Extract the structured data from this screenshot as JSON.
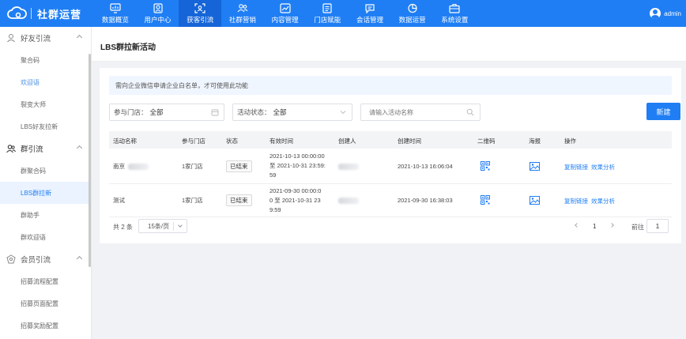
{
  "brand": {
    "name": "社群运营"
  },
  "nav": [
    {
      "label": "数据概览",
      "icon": "chart-screen-icon"
    },
    {
      "label": "用户中心",
      "icon": "user-icon"
    },
    {
      "label": "获客引流",
      "icon": "scan-icon",
      "active": true
    },
    {
      "label": "社群营销",
      "icon": "group-icon"
    },
    {
      "label": "内容管理",
      "icon": "trend-icon"
    },
    {
      "label": "门店赋能",
      "icon": "store-icon"
    },
    {
      "label": "会话管理",
      "icon": "chat-icon"
    },
    {
      "label": "数据运营",
      "icon": "pie-icon"
    },
    {
      "label": "系统设置",
      "icon": "briefcase-icon"
    }
  ],
  "user": {
    "name": "admin"
  },
  "sidebar": {
    "groups": [
      {
        "label": "好友引流",
        "icon": "friend-icon",
        "items": [
          "聚合码",
          "欢迎语",
          "裂变大师",
          "LBS好友拉新"
        ]
      },
      {
        "label": "群引流",
        "icon": "group-user-icon",
        "items": [
          "群聚合码",
          "LBS群拉新",
          "群助手",
          "群欢迎语"
        ]
      },
      {
        "label": "会员引流",
        "icon": "member-icon",
        "items": [
          "招募流程配置",
          "招募页面配置",
          "招募奖励配置"
        ]
      }
    ]
  },
  "page": {
    "title": "LBS群拉新活动"
  },
  "notice": "需向企业微信申请企业白名单，才可使用此功能",
  "filters": {
    "store_label": "参与门店：",
    "store_value": "全部",
    "status_label": "活动状态：",
    "status_value": "全部",
    "search_placeholder": "请输入活动名称",
    "new_button": "新建"
  },
  "table": {
    "headers": [
      "活动名称",
      "参与门店",
      "状态",
      "有效时间",
      "创建人",
      "创建时间",
      "二维码",
      "海报",
      "操作"
    ],
    "rows": [
      {
        "name": "南京",
        "stores": "1家门店",
        "status": "已结束",
        "valid_line1": "2021-10-13 00:00:00",
        "valid_line2": "至 2021-10-31 23:59:",
        "valid_line3": "59",
        "created_at": "2021-10-13 16:06:04",
        "action_copy": "复制链接",
        "action_analyze": "效果分析"
      },
      {
        "name": "测试",
        "stores": "1家门店",
        "status": "已结束",
        "valid_line1": "2021-09-30 00:00:0",
        "valid_line2": "0 至 2021-10-31 23",
        "valid_line3": "9:59",
        "created_at": "2021-09-30 16:38:03",
        "action_copy": "复制链接",
        "action_analyze": "效果分析"
      }
    ]
  },
  "pagination": {
    "total": "共 2 条",
    "page_size": "15条/页",
    "current": "1",
    "goto_label": "前往",
    "goto_value": "1"
  },
  "colors": {
    "primary": "#1f7ef4",
    "active_nav": "#1565d8",
    "background": "#f0f2f5"
  }
}
